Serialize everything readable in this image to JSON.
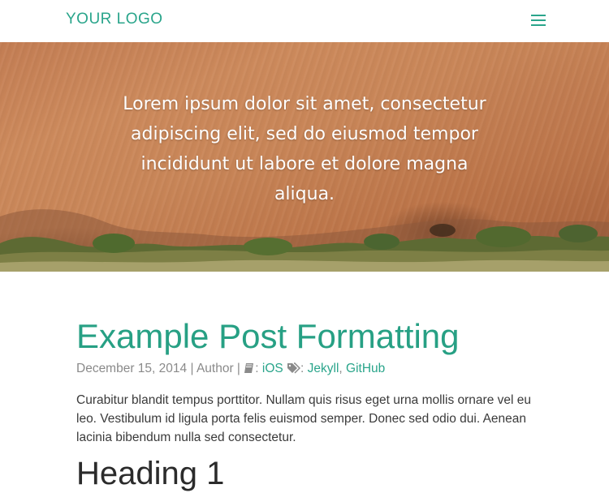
{
  "header": {
    "logo": "YOUR LOGO",
    "menu_icon": "hamburger-menu-icon"
  },
  "hero": {
    "text": "Lorem ipsum dolor sit amet, consectetur adipiscing elit, sed do eiusmod tempor incididunt ut labore et dolore magna aliqua."
  },
  "post": {
    "title": "Example Post Formatting",
    "date": "December 15, 2014",
    "separator": " | ",
    "author": "Author",
    "category_icon": "book-icon",
    "category": "iOS",
    "tags_icon": "tags-icon",
    "tags": [
      "Jekyll",
      "GitHub"
    ],
    "body": "Curabitur blandit tempus porttitor. Nullam quis risus eget urna mollis ornare vel eu leo. Vestibulum id ligula porta felis euismod semper. Donec sed odio dui. Aenean lacinia bibendum nulla sed consectetur.",
    "heading": "Heading 1"
  },
  "colors": {
    "accent": "#2aa58b",
    "meta_text": "#8a8a8a",
    "body_text": "#3a3a3a"
  }
}
